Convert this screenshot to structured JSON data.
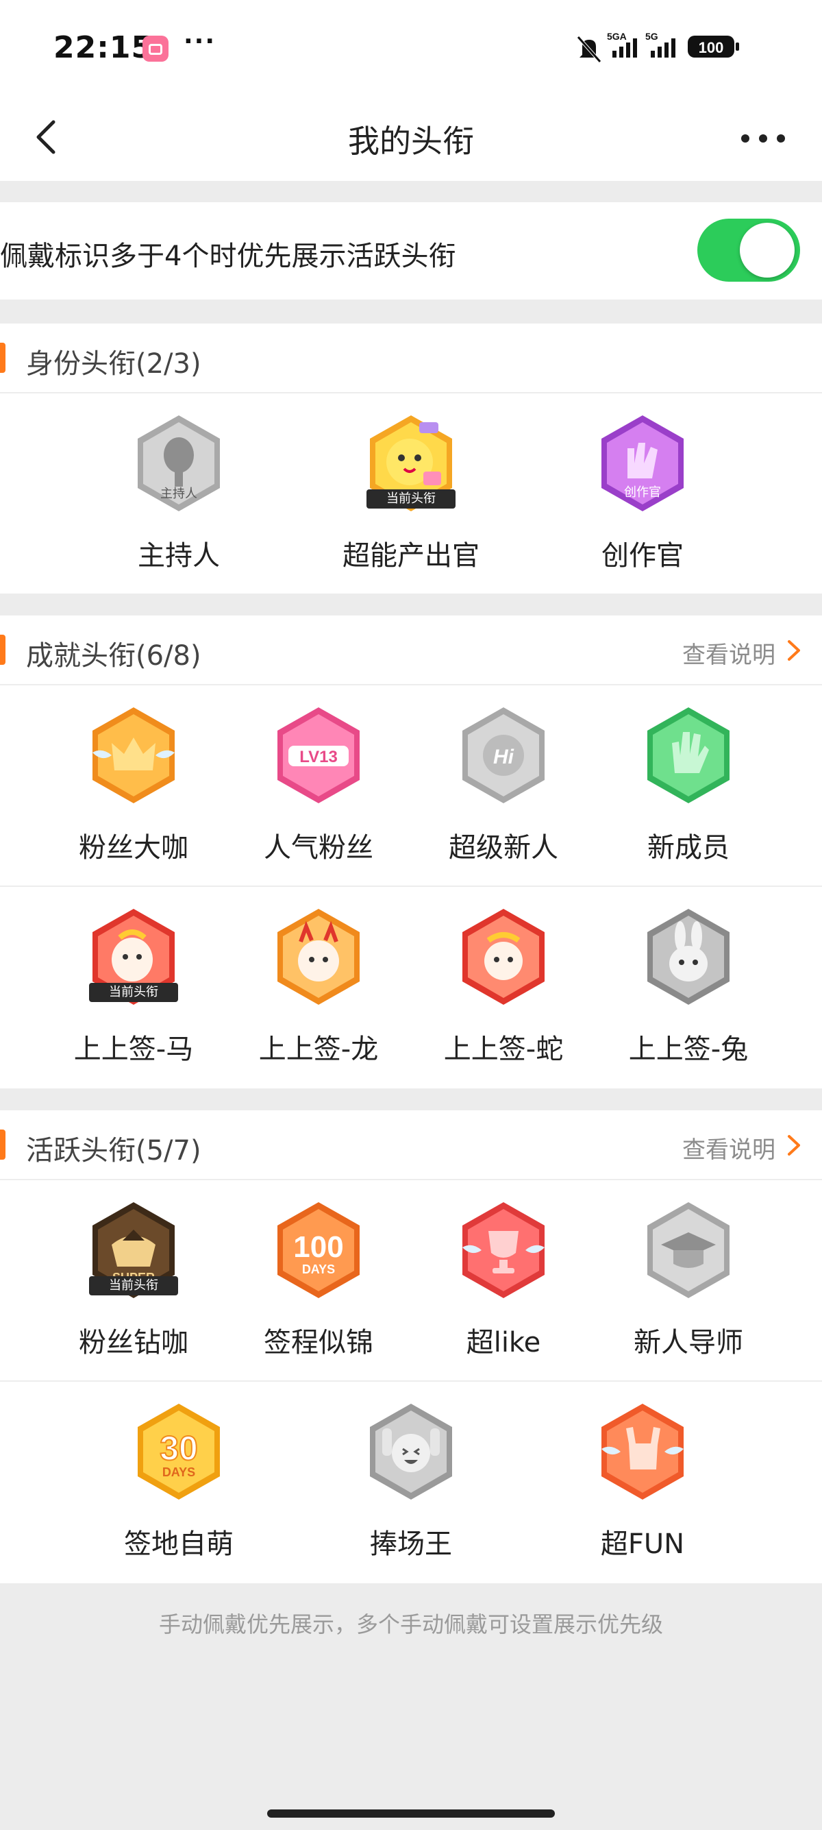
{
  "status_bar": {
    "time": "22:15",
    "battery": "100",
    "net1": "5GA",
    "net2": "5G"
  },
  "header": {
    "title": "我的头衔"
  },
  "toggle": {
    "label": "佩戴标识多于4个时优先展示活跃头衔",
    "on": true
  },
  "identity": {
    "title": "身份头衔(2/3)",
    "items": [
      {
        "label": "主持人",
        "badge_text": "主持人",
        "icon": "mic-icon"
      },
      {
        "label": "超能产出官",
        "badge_text": "",
        "current_tag": "当前头衔",
        "icon": "chick-icon"
      },
      {
        "label": "创作官",
        "badge_text": "创作官",
        "icon": "hand-icon"
      }
    ]
  },
  "achievement": {
    "title": "成就头衔(6/8)",
    "link": "查看说明",
    "items": [
      {
        "label": "粉丝大咖",
        "badge_text": "",
        "icon": "crown-icon"
      },
      {
        "label": "人气粉丝",
        "badge_text": "LV13",
        "icon": "level-icon"
      },
      {
        "label": "超级新人",
        "badge_text": "Hi",
        "icon": "hi-icon"
      },
      {
        "label": "新成员",
        "badge_text": "",
        "icon": "wave-hand-icon"
      },
      {
        "label": "上上签-马",
        "badge_text": "",
        "current_tag": "当前头衔",
        "icon": "horse-icon"
      },
      {
        "label": "上上签-龙",
        "badge_text": "",
        "icon": "dragon-icon"
      },
      {
        "label": "上上签-蛇",
        "badge_text": "",
        "icon": "snake-icon"
      },
      {
        "label": "上上签-兔",
        "badge_text": "",
        "icon": "rabbit-icon"
      }
    ]
  },
  "active": {
    "title": "活跃头衔(5/7)",
    "link": "查看说明",
    "items": [
      {
        "label": "粉丝钻咖",
        "badge_text": "SUPER",
        "current_tag": "当前头衔",
        "icon": "super-icon"
      },
      {
        "label": "签程似锦",
        "badge_text": "100",
        "badge_sub": "DAYS",
        "icon": "days100-icon"
      },
      {
        "label": "超like",
        "badge_text": "",
        "icon": "trophy-icon"
      },
      {
        "label": "新人导师",
        "badge_text": "",
        "icon": "grad-cap-icon"
      },
      {
        "label": "签地自萌",
        "badge_text": "30",
        "badge_sub": "DAYS",
        "icon": "days30-icon"
      },
      {
        "label": "捧场王",
        "badge_text": "",
        "icon": "cheer-icon"
      },
      {
        "label": "超FUN",
        "badge_text": "",
        "icon": "rock-hand-icon"
      }
    ]
  },
  "footer": {
    "note": "手动佩戴优先展示，多个手动佩戴可设置展示优先级"
  },
  "colors": {
    "accent": "#ff7a1a",
    "switch_on": "#2ccc5a",
    "orange": "#f7a53a",
    "pink": "#f0609a",
    "gray": "#bdbdbd",
    "green": "#4fcf70",
    "red": "#f06a5a",
    "purple": "#b45ad6",
    "gold": "#f5c23a",
    "brown": "#6b4a2a"
  }
}
